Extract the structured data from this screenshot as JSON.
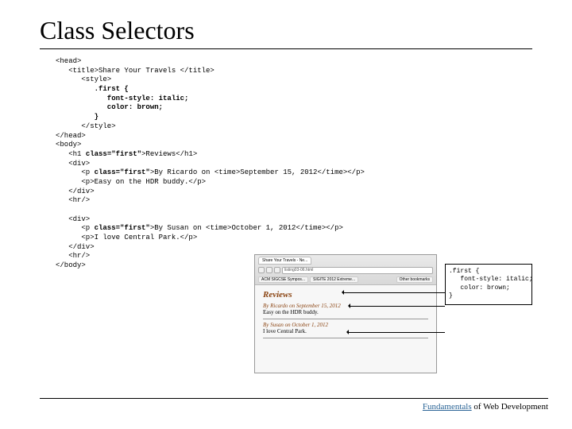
{
  "title": "Class Selectors",
  "code": {
    "l1": "<head>",
    "l2": "   <title>Share Your Travels </title>",
    "l3": "      <style>",
    "l4": "         .first {",
    "l5": "            font-style: italic;",
    "l6": "            color: brown;",
    "l7": "         }",
    "l8": "      </style>",
    "l9": "</head>",
    "l10": "<body>",
    "l11a": "   <h1 ",
    "l11b": "class=\"first\"",
    "l11c": ">Reviews</h1>",
    "l12": "   <div>",
    "l13a": "      <p ",
    "l13b": "class=\"first\"",
    "l13c": ">By Ricardo on <time>September 15, 2012</time></p>",
    "l14": "      <p>Easy on the HDR buddy.</p>",
    "l15": "   </div>",
    "l16": "   <hr/>",
    "l17": "",
    "l18": "   <div>",
    "l19a": "      <p ",
    "l19b": "class=\"first\"",
    "l19c": ">By Susan on <time>October 1, 2012</time></p>",
    "l20": "      <p>I love Central Park.</p>",
    "l21": "   </div>",
    "l22": "   <hr/>",
    "l23": "</body>"
  },
  "browser": {
    "tab": "Share Your Travels - Ne...",
    "addr": "listing03-06.html",
    "bm1": "ACM SIGCSE Sympos...",
    "bm2": "SIGITE 2012 Extreme...",
    "bm_other": "Other bookmarks",
    "h1": "Reviews",
    "p1": "By Ricardo on September 15, 2012",
    "p2": "Easy on the HDR buddy.",
    "p3": "By Susan on October 1, 2012",
    "p4": "I love Central Park."
  },
  "callout": ".first {\n   font-style: italic;\n   color: brown;\n}",
  "footer": {
    "fund": "Fundamentals",
    "rest": " of Web Development"
  }
}
